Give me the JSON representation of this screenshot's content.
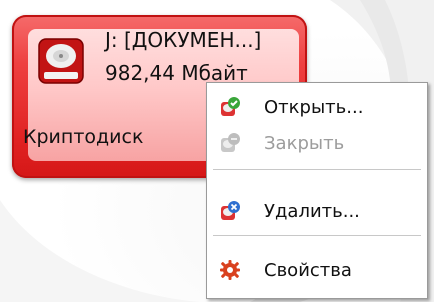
{
  "disk": {
    "title": "J: [ДОКУМЕН...]",
    "size": "982,44 Мбайт",
    "label": "Криптодиск",
    "accent_color": "#e12323"
  },
  "menu": {
    "items": [
      {
        "label": "Открыть...",
        "icon": "open-disk-icon",
        "enabled": true
      },
      {
        "label": "Закрыть",
        "icon": "close-disk-icon",
        "enabled": false
      },
      {
        "label": "Удалить...",
        "icon": "delete-disk-icon",
        "enabled": true
      },
      {
        "label": "Свойства",
        "icon": "properties-gear-icon",
        "enabled": true
      }
    ]
  }
}
